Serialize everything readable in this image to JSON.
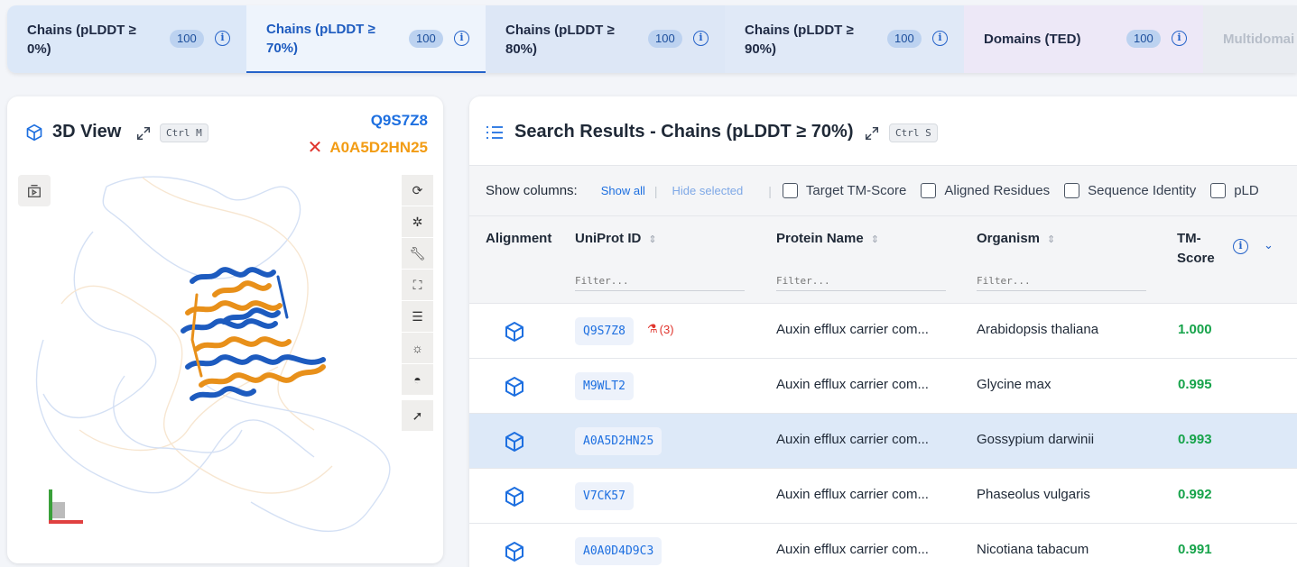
{
  "tabs": [
    {
      "label": "Chains (pLDDT ≥ 0%)",
      "count": "100"
    },
    {
      "label": "Chains (pLDDT ≥ 70%)",
      "count": "100"
    },
    {
      "label": "Chains (pLDDT ≥ 80%)",
      "count": "100"
    },
    {
      "label": "Chains (pLDDT ≥ 90%)",
      "count": "100"
    },
    {
      "label": "Domains (TED)",
      "count": "100"
    },
    {
      "label": "Multidomai"
    }
  ],
  "viewer": {
    "title": "3D View",
    "shortcut": "Ctrl M",
    "query_id": "Q9S7Z8",
    "target_id": "A0A5D2HN25",
    "colors": {
      "query": "#1d5bbf",
      "target": "#f29c14"
    }
  },
  "results": {
    "title": "Search Results - Chains (pLDDT ≥ 70%)",
    "shortcut": "Ctrl S",
    "show_columns_label": "Show columns:",
    "show_all": "Show all",
    "hide_selected": "Hide selected",
    "optional_columns": [
      "Target TM-Score",
      "Aligned Residues",
      "Sequence Identity",
      "pLD"
    ],
    "headers": {
      "alignment": "Alignment",
      "uniprot": "UniProt ID",
      "protein": "Protein Name",
      "organism": "Organism",
      "tm": "TM-Score"
    },
    "filter_placeholder": "Filter...",
    "rows": [
      {
        "uniprot": "Q9S7Z8",
        "experiments": "(3)",
        "protein": "Auxin efflux carrier com...",
        "organism": "Arabidopsis thaliana",
        "tm": "1.000"
      },
      {
        "uniprot": "M9WLT2",
        "protein": "Auxin efflux carrier com...",
        "organism": "Glycine max",
        "tm": "0.995"
      },
      {
        "uniprot": "A0A5D2HN25",
        "protein": "Auxin efflux carrier com...",
        "organism": "Gossypium darwinii",
        "tm": "0.993"
      },
      {
        "uniprot": "V7CK57",
        "protein": "Auxin efflux carrier com...",
        "organism": "Phaseolus vulgaris",
        "tm": "0.992"
      },
      {
        "uniprot": "A0A0D4D9C3",
        "protein": "Auxin efflux carrier com...",
        "organism": "Nicotiana tabacum",
        "tm": "0.991"
      }
    ]
  }
}
